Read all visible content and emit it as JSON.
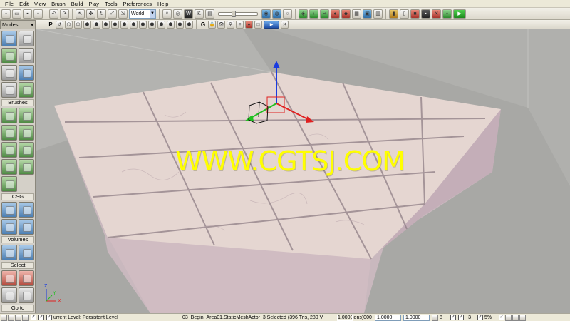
{
  "menubar": {
    "items": [
      "File",
      "Edit",
      "View",
      "Brush",
      "Build",
      "Play",
      "Tools",
      "Preferences",
      "Help"
    ]
  },
  "toolbar": {
    "coordinate_system": "World"
  },
  "modes_panel": {
    "title": "Modes",
    "sections": {
      "brushes": "Brushes",
      "csg": "CSG",
      "volumes": "Volumes",
      "select": "Select",
      "goto": "Go to"
    }
  },
  "viewport_toolbar": {
    "perspective_label": "P",
    "game_label": "G"
  },
  "viewport": {
    "watermark": "WWW.CGTSJ.COM",
    "axis_labels": [
      "X",
      "Y",
      "Z"
    ],
    "colors": {
      "background": "#a8a8a5",
      "floor_top": "#e5d6d1",
      "floor_side": "#c9b8be",
      "gizmo_z": "#1a3ce0",
      "gizmo_x": "#e02020",
      "gizmo_y": "#20c020",
      "watermark": "#ffff00"
    }
  },
  "statusbar": {
    "current_level": "urrent Level:  Persistent Level",
    "selection": "03_Begin_Area01.StaticMeshActor_3 Selected (396 Tris, 280 V",
    "drag_scale_value": "1.0000",
    "drag_scale_suffix": "ions)000",
    "scale_y": "1.0000",
    "scale_z": "1.0000",
    "grid_size": "8",
    "rotation_snap": "~3",
    "scale_snap": "5%"
  }
}
